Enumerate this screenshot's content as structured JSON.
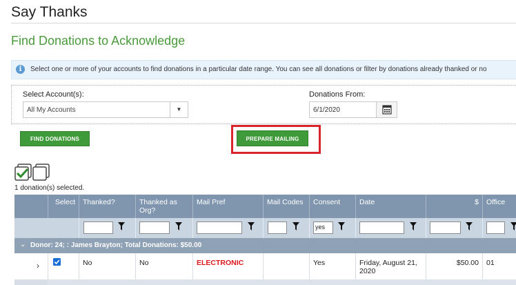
{
  "page": {
    "title": "Say Thanks",
    "section_title": "Find Donations to Acknowledge"
  },
  "info": {
    "icon": "info-icon",
    "text": "Select one or more of your accounts to find donations in a particular date range. You can see all donations or filter by donations already thanked or no"
  },
  "filters": {
    "account_label": "Select Account(s):",
    "account_value": "All My Accounts",
    "from_label": "Donations From:",
    "from_value": "6/1/2020"
  },
  "buttons": {
    "find": "FIND DONATIONS",
    "prepare": "PREPARE MAILING"
  },
  "colors": {
    "accent_green": "#3f9a3a",
    "highlight_red": "#d9232d",
    "electronic_red": "#e0181e",
    "grid_header": "#7f96ae"
  },
  "grid": {
    "selected_text": "1 donation(s) selected.",
    "columns": [
      "Select",
      "Thanked?",
      "Thanked as Org?",
      "Mail Pref",
      "Mail Codes",
      "Consent",
      "Date",
      "$",
      "Office"
    ],
    "filter_consent": "yes",
    "group_label": "Donor: 24; : James Brayton; Total Donations: $50.00",
    "row": {
      "thanked": "No",
      "thanked_org": "No",
      "mail_pref": "ELECTRONIC",
      "mail_codes": "",
      "consent": "Yes",
      "date": "Friday, August 21, 2020",
      "amount": "$50.00",
      "office": "01"
    }
  }
}
